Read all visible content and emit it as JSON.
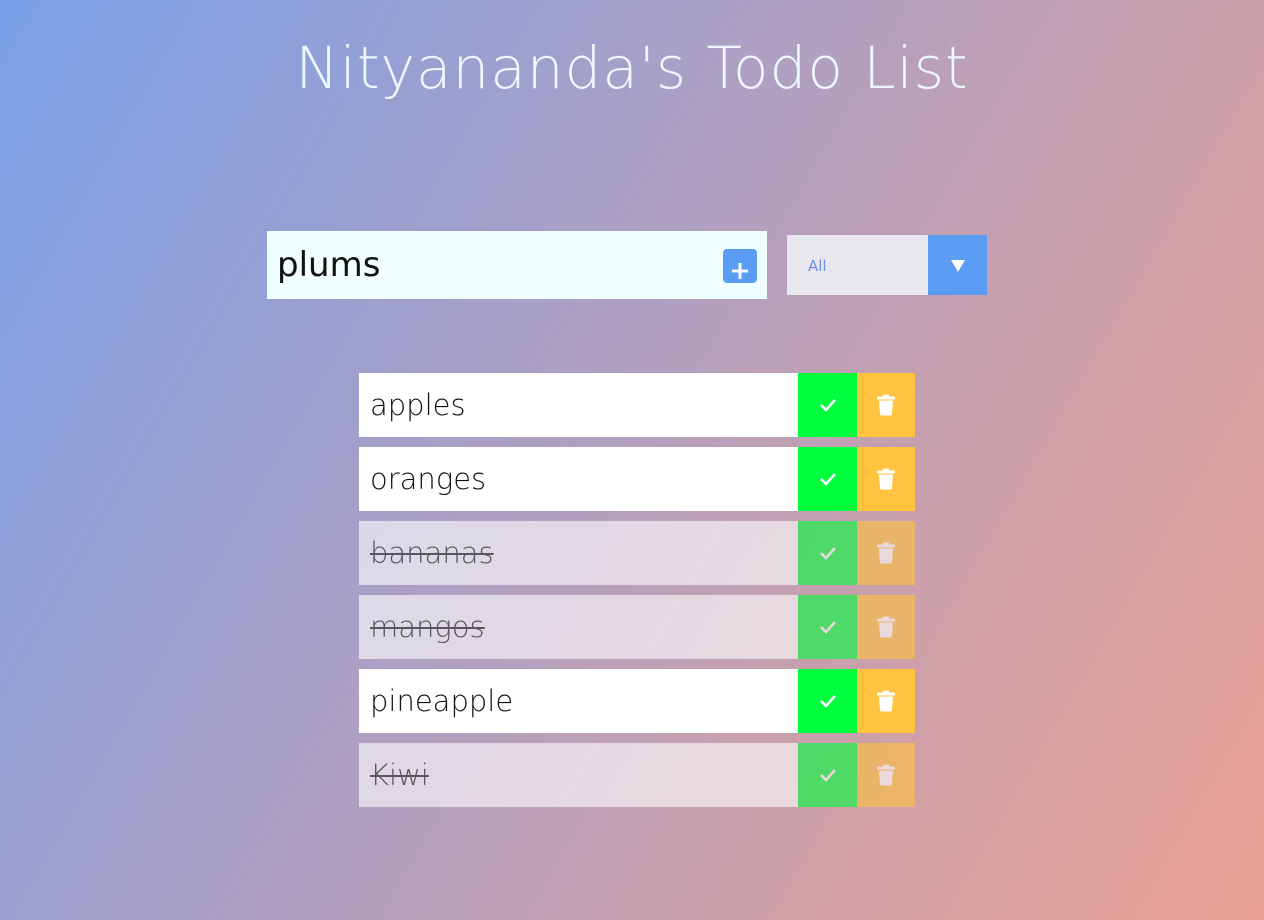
{
  "header": {
    "title": "Nityananda's Todo List"
  },
  "form": {
    "input_value": "plums",
    "add_icon": "plus-icon",
    "filter": {
      "selected": "All",
      "icon": "dropdown-arrow-icon"
    }
  },
  "todos": [
    {
      "text": "apples",
      "completed": false
    },
    {
      "text": "oranges",
      "completed": false
    },
    {
      "text": "bananas",
      "completed": true
    },
    {
      "text": "mangos",
      "completed": true
    },
    {
      "text": "pineapple",
      "completed": false
    },
    {
      "text": "Kiwi",
      "completed": true
    }
  ],
  "colors": {
    "accent_blue": "#5b9cf5",
    "check_green": "#00ff3c",
    "trash_yellow": "#ffc340",
    "input_bg": "#effffd"
  }
}
